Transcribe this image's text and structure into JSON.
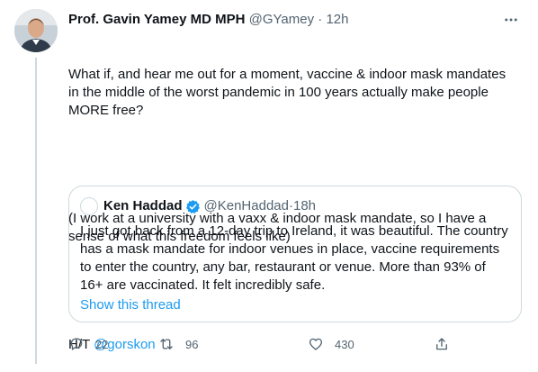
{
  "tweet": {
    "author_name": "Prof. Gavin Yamey MD MPH",
    "handle": "@GYamey",
    "separator": " · ",
    "time": "12h",
    "text_p1": "What if, and hear me out for a moment, vaccine & indoor mask mandates in the middle of the worst pandemic in 100 years actually make people MORE free?",
    "text_p2": "(I work at a university with a vaxx & indoor mask mandate, so I have a sense of what this freedom feels like)",
    "text_p3_prefix": "H/T ",
    "text_p3_mention": "@gorskon"
  },
  "quote": {
    "author_name": "Ken Haddad",
    "handle": "@KenHaddad",
    "separator": " · ",
    "time": "18h",
    "text": "I just got back from a 12-day trip to Ireland, it was beautiful. The country has a mask mandate for indoor venues in place, vaccine requirements to enter the country, any bar, restaurant or venue. More than 93% of 16+ are vaccinated. It felt incredibly safe.",
    "show_thread": "Show this thread"
  },
  "actions": {
    "replies": "22",
    "retweets": "96",
    "likes": "430"
  },
  "icons": {
    "more": "more-horizontal-icon",
    "reply": "reply-icon",
    "retweet": "retweet-icon",
    "like": "heart-icon",
    "share": "share-icon",
    "verified": "verified-badge-icon"
  },
  "colors": {
    "link": "#1d9bf0",
    "secondary_text": "#536471",
    "border": "#cfd9de"
  }
}
